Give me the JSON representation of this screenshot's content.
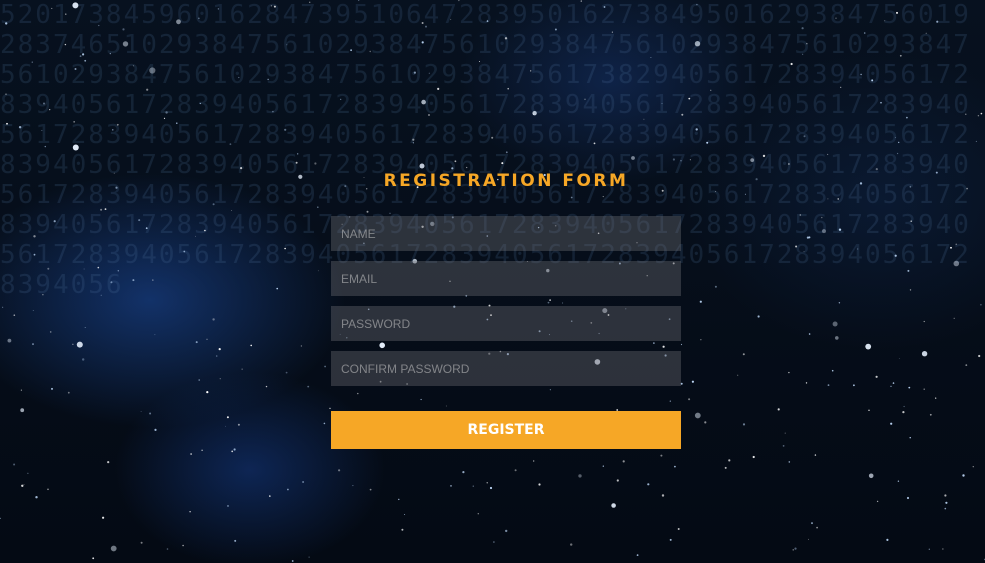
{
  "form": {
    "title": "REGISTRATION FORM",
    "fields": [
      {
        "name": "name",
        "placeholder": "NAME",
        "value": ""
      },
      {
        "name": "email",
        "placeholder": "EMAIL",
        "value": ""
      },
      {
        "name": "password",
        "placeholder": "PASSWORD",
        "value": ""
      },
      {
        "name": "confirm_password",
        "placeholder": "CONFIRM PASSWORD",
        "value": ""
      }
    ],
    "submit_label": "REGISTER"
  },
  "colors": {
    "accent": "#f6a726",
    "background": "#050c17",
    "field_bg": "rgba(120,120,125,0.35)"
  }
}
